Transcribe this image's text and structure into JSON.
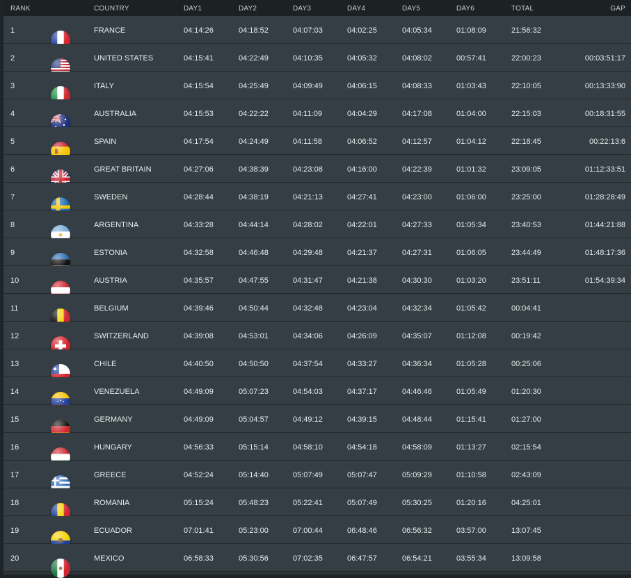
{
  "header": {
    "rank": "RANK",
    "country": "COUNTRY",
    "day1": "DAY1",
    "day2": "DAY2",
    "day3": "DAY3",
    "day4": "DAY4",
    "day5": "DAY5",
    "day6": "DAY6",
    "total": "TOTAL",
    "gap": "GAP"
  },
  "rows": [
    {
      "rank": "1",
      "flag": "france-flag-icon",
      "country": "FRANCE",
      "day1": "04:14:26",
      "day2": "04:18:52",
      "day3": "04:07:03",
      "day4": "04:02:25",
      "day5": "04:05:34",
      "day6": "01:08:09",
      "total": "21:56:32",
      "gap": ""
    },
    {
      "rank": "2",
      "flag": "united-states-flag-icon",
      "country": "UNITED STATES",
      "day1": "04:15:41",
      "day2": "04:22:49",
      "day3": "04:10:35",
      "day4": "04:05:32",
      "day5": "04:08:02",
      "day6": "00:57:41",
      "total": "22:00:23",
      "gap": "00:03:51:17"
    },
    {
      "rank": "3",
      "flag": "italy-flag-icon",
      "country": "ITALY",
      "day1": "04:15:54",
      "day2": "04:25:49",
      "day3": "04:09:49",
      "day4": "04:06:15",
      "day5": "04:08:33",
      "day6": "01:03:43",
      "total": "22:10:05",
      "gap": "00:13:33:90"
    },
    {
      "rank": "4",
      "flag": "australia-flag-icon",
      "country": "AUSTRALIA",
      "day1": "04:15:53",
      "day2": "04:22:22",
      "day3": "04:11:09",
      "day4": "04:04:29",
      "day5": "04:17:08",
      "day6": "01:04:00",
      "total": "22:15:03",
      "gap": "00:18:31:55"
    },
    {
      "rank": "5",
      "flag": "spain-flag-icon",
      "country": "SPAIN",
      "day1": "04:17:54",
      "day2": "04:24:49",
      "day3": "04:11:58",
      "day4": "04:06:52",
      "day5": "04:12:57",
      "day6": "01:04:12",
      "total": "22:18:45",
      "gap": "00:22:13:6"
    },
    {
      "rank": "6",
      "flag": "great-britain-flag-icon",
      "country": "GREAT BRITAIN",
      "day1": "04:27:06",
      "day2": "04:38:39",
      "day3": "04:23:08",
      "day4": "04:16:00",
      "day5": "04:22:39",
      "day6": "01:01:32",
      "total": "23:09:05",
      "gap": "01:12:33:51"
    },
    {
      "rank": "7",
      "flag": "sweden-flag-icon",
      "country": "SWEDEN",
      "day1": "04:28:44",
      "day2": "04:38:19",
      "day3": "04:21:13",
      "day4": "04:27:41",
      "day5": "04:23:00",
      "day6": "01:06:00",
      "total": "23:25:00",
      "gap": "01:28:28:49"
    },
    {
      "rank": "8",
      "flag": "argentina-flag-icon",
      "country": "ARGENTINA",
      "day1": "04:33:28",
      "day2": "04:44:14",
      "day3": "04:28:02",
      "day4": "04:22:01",
      "day5": "04:27:33",
      "day6": "01:05:34",
      "total": "23:40:53",
      "gap": "01:44:21:88"
    },
    {
      "rank": "9",
      "flag": "estonia-flag-icon",
      "country": "ESTONIA",
      "day1": "04:32:58",
      "day2": "04:46:48",
      "day3": "04:29:48",
      "day4": "04:21:37",
      "day5": "04:27:31",
      "day6": "01:06:05",
      "total": "23:44:49",
      "gap": "01:48:17:36"
    },
    {
      "rank": "10",
      "flag": "austria-flag-icon",
      "country": "AUSTRIA",
      "day1": "04:35:57",
      "day2": "04:47:55",
      "day3": "04:31:47",
      "day4": "04:21:38",
      "day5": "04:30:30",
      "day6": "01:03:20",
      "total": "23:51:11",
      "gap": "01:54:39:34"
    },
    {
      "rank": "11",
      "flag": "belgium-flag-icon",
      "country": "BELGIUM",
      "day1": "04:39:46",
      "day2": "04:50:44",
      "day3": "04:32:48",
      "day4": "04:23:04",
      "day5": "04:32:34",
      "day6": "01:05:42",
      "total": "00:04:41",
      "gap": ""
    },
    {
      "rank": "12",
      "flag": "switzerland-flag-icon",
      "country": "SWITZERLAND",
      "day1": "04:39:08",
      "day2": "04:53:01",
      "day3": "04:34:06",
      "day4": "04:26:09",
      "day5": "04:35:07",
      "day6": "01:12:08",
      "total": "00:19:42",
      "gap": ""
    },
    {
      "rank": "13",
      "flag": "chile-flag-icon",
      "country": "CHILE",
      "day1": "04:40:50",
      "day2": "04:50:50",
      "day3": "04:37:54",
      "day4": "04:33:27",
      "day5": "04:36:34",
      "day6": "01:05:28",
      "total": "00:25:06",
      "gap": ""
    },
    {
      "rank": "14",
      "flag": "venezuela-flag-icon",
      "country": "VENEZUELA",
      "day1": "04:49:09",
      "day2": "05:07:23",
      "day3": "04:54:03",
      "day4": "04:37:17",
      "day5": "04:46:46",
      "day6": "01:05:49",
      "total": "01:20:30",
      "gap": ""
    },
    {
      "rank": "15",
      "flag": "germany-flag-icon",
      "country": "GERMANY",
      "day1": "04:49:09",
      "day2": "05:04:57",
      "day3": "04:49:12",
      "day4": "04:39:15",
      "day5": "04:48:44",
      "day6": "01:15:41",
      "total": "01:27:00",
      "gap": ""
    },
    {
      "rank": "16",
      "flag": "hungary-flag-icon",
      "country": "HUNGARY",
      "day1": "04:56:33",
      "day2": "05:15:14",
      "day3": "04:58:10",
      "day4": "04:54:18",
      "day5": "04:58:09",
      "day6": "01:13:27",
      "total": "02:15:54",
      "gap": ""
    },
    {
      "rank": "17",
      "flag": "greece-flag-icon",
      "country": "GREECE",
      "day1": "04:52:24",
      "day2": "05:14:40",
      "day3": "05:07:49",
      "day4": "05:07:47",
      "day5": "05:09:29",
      "day6": "01:10:58",
      "total": "02:43:09",
      "gap": ""
    },
    {
      "rank": "18",
      "flag": "romania-flag-icon",
      "country": "ROMANIA",
      "day1": "05:15:24",
      "day2": "05:48:23",
      "day3": "05:22:41",
      "day4": "05:07:49",
      "day5": "05:30:25",
      "day6": "01:20:16",
      "total": "04:25:01",
      "gap": ""
    },
    {
      "rank": "19",
      "flag": "ecuador-flag-icon",
      "country": "ECUADOR",
      "day1": "07:01:41",
      "day2": "05:23:00",
      "day3": "07:00:44",
      "day4": "06:48:46",
      "day5": "06:56:32",
      "day6": "03:57:00",
      "total": "13:07:45",
      "gap": ""
    },
    {
      "rank": "20",
      "flag": "mexico-flag-icon",
      "country": "MEXICO",
      "day1": "06:58:33",
      "day2": "05:30:56",
      "day3": "07:02:35",
      "day4": "06:47:57",
      "day5": "06:54:21",
      "day6": "03:55:34",
      "total": "13:09:58",
      "gap": ""
    }
  ]
}
